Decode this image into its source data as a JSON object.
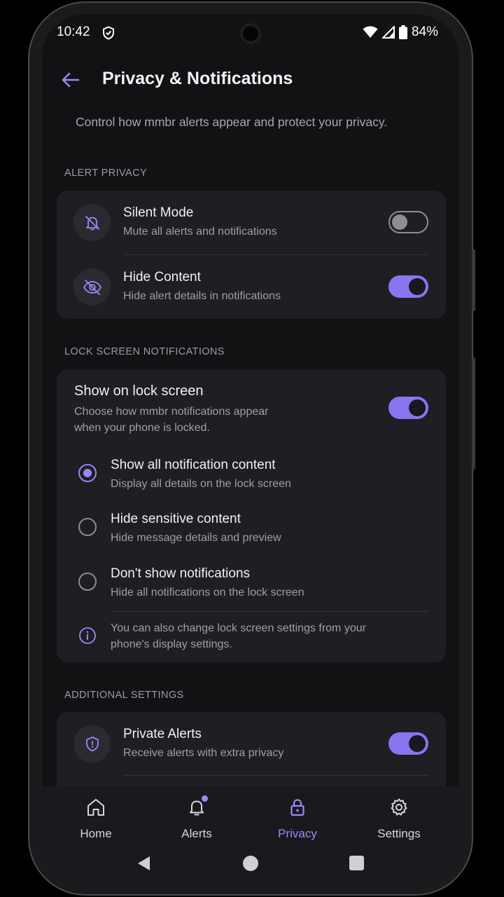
{
  "status": {
    "time": "10:42",
    "battery": "84%"
  },
  "header": {
    "title": "Privacy & Notifications",
    "subtitle": "Control how mmbr alerts appear and protect your privacy."
  },
  "alert_privacy": {
    "label": "ALERT PRIVACY",
    "items": [
      {
        "title": "Silent Mode",
        "subtitle": "Mute all alerts and notifications",
        "enabled": false,
        "icon": "bell-off-icon"
      },
      {
        "title": "Hide Content",
        "subtitle": "Hide alert details in notifications",
        "enabled": true,
        "icon": "eye-off-icon"
      }
    ]
  },
  "lock_screen": {
    "label": "LOCK SCREEN NOTIFICATIONS",
    "title": "Show on lock screen",
    "subtitle_line1": "Choose how mmbr notifications appear",
    "subtitle_line2": "when your phone is locked.",
    "enabled": true,
    "options": [
      {
        "title": "Show all notification content",
        "subtitle": "Display all details on the lock screen",
        "selected": true
      },
      {
        "title": "Hide sensitive content",
        "subtitle": "Hide message details and preview",
        "selected": false
      },
      {
        "title": "Don't show notifications",
        "subtitle": "Hide all notifications on the lock screen",
        "selected": false
      }
    ],
    "info_line1": "You can also change lock screen settings from your",
    "info_line2": "phone's display settings."
  },
  "additional": {
    "label": "ADDITIONAL SETTINGS",
    "items": [
      {
        "title": "Private Alerts",
        "subtitle": "Receive alerts with extra privacy",
        "enabled": true,
        "icon": "shield-icon"
      }
    ]
  },
  "nav": {
    "items": [
      {
        "label": "Home",
        "icon": "home-icon"
      },
      {
        "label": "Alerts",
        "icon": "bell-icon"
      },
      {
        "label": "Privacy",
        "icon": "lock-icon",
        "active": true
      },
      {
        "label": "Settings",
        "icon": "gear-icon"
      }
    ]
  },
  "colors": {
    "accent": "#8a74f0",
    "background": "#121214",
    "card": "#1e1e23"
  }
}
